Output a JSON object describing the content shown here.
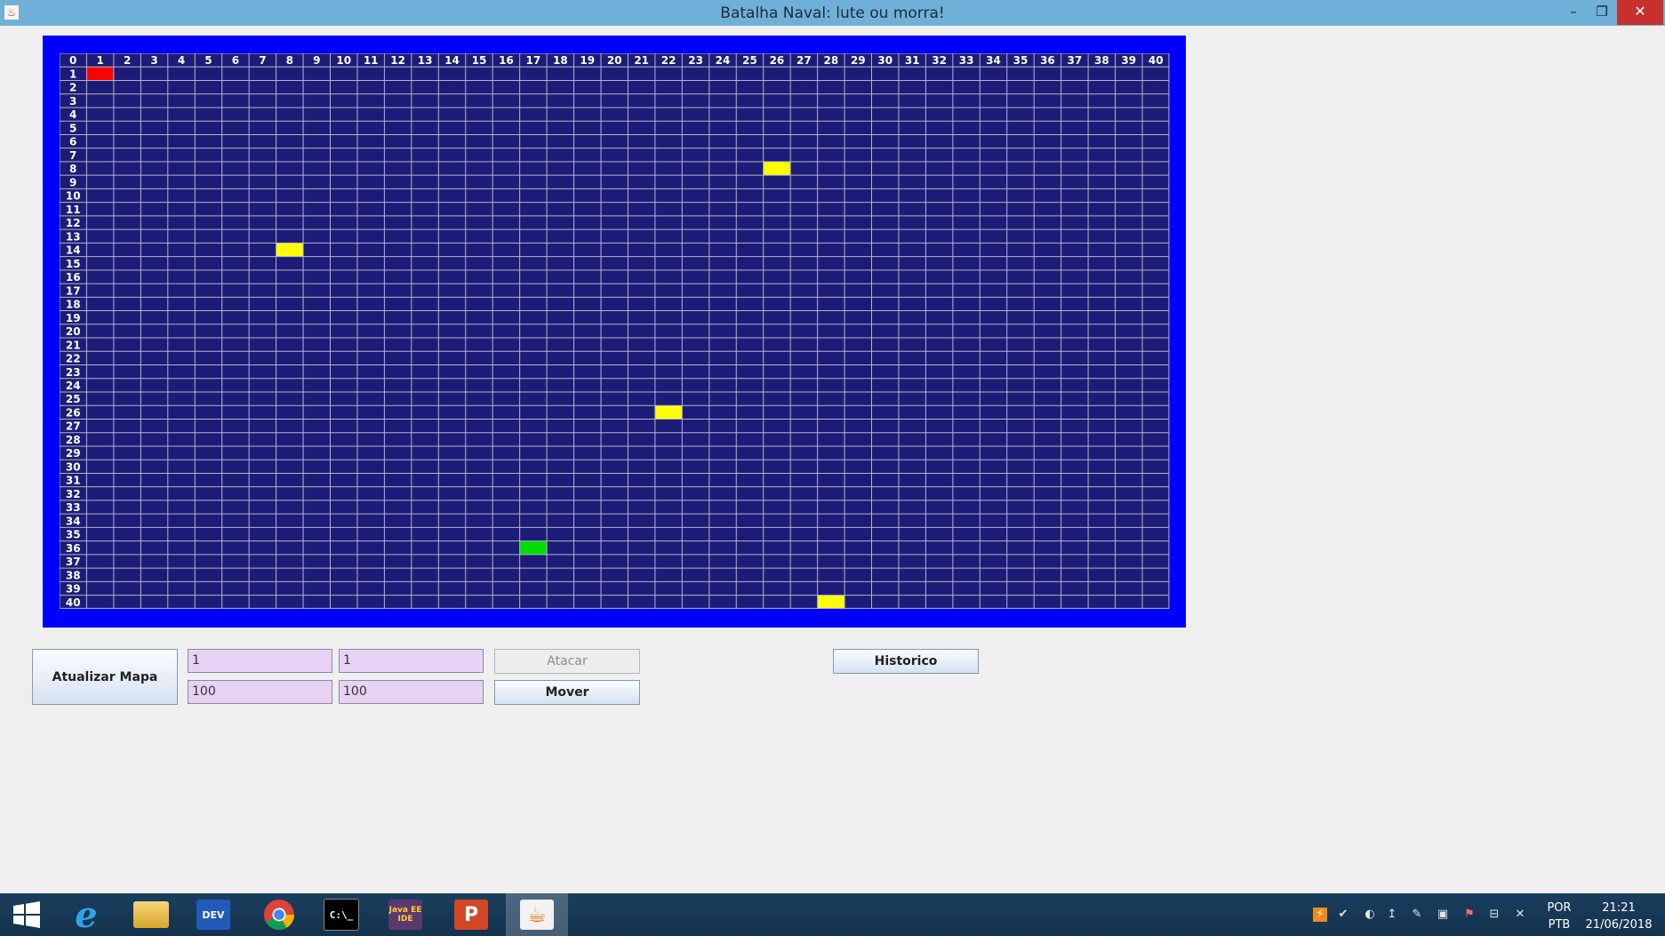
{
  "window": {
    "title": "Batalha Naval: lute ou morra!",
    "min_glyph": "–",
    "max_glyph": "❐",
    "close_glyph": "✕"
  },
  "board": {
    "rows": 40,
    "cols": 40,
    "corner_label": "0",
    "colors": {
      "frame": "#0000ff",
      "water": "#1c1c78",
      "grid_line": "#b4b4c8",
      "label": "#ffffff"
    },
    "cells": [
      {
        "row": 1,
        "col": 1,
        "color": "#ff0000",
        "kind": "red"
      },
      {
        "row": 8,
        "col": 26,
        "color": "#ffff00",
        "kind": "yellow"
      },
      {
        "row": 14,
        "col": 8,
        "color": "#ffff00",
        "kind": "yellow"
      },
      {
        "row": 26,
        "col": 22,
        "color": "#ffff00",
        "kind": "yellow"
      },
      {
        "row": 36,
        "col": 17,
        "color": "#00dd00",
        "kind": "green"
      },
      {
        "row": 40,
        "col": 28,
        "color": "#ffff00",
        "kind": "yellow"
      }
    ]
  },
  "controls": {
    "atualizar_label": "Atualizar Mapa",
    "field_1": "1",
    "field_2": "1",
    "field_3": "100",
    "field_4": "100",
    "atacar_label": "Atacar",
    "mover_label": "Mover",
    "historico_label": "Historico"
  },
  "taskbar": {
    "apps": [
      {
        "name": "start",
        "label": ""
      },
      {
        "name": "internet-explorer",
        "label": "e"
      },
      {
        "name": "file-explorer",
        "label": ""
      },
      {
        "name": "dev-cpp",
        "label": "DEV"
      },
      {
        "name": "chrome",
        "label": ""
      },
      {
        "name": "command-prompt",
        "label": "C:\\_"
      },
      {
        "name": "java-ee-ide",
        "label": "Java EE IDE"
      },
      {
        "name": "powerpoint",
        "label": "P"
      },
      {
        "name": "java",
        "label": "☕"
      }
    ],
    "language_line1": "POR",
    "language_line2": "PTB",
    "time": "21:21",
    "date": "21/06/2018"
  }
}
